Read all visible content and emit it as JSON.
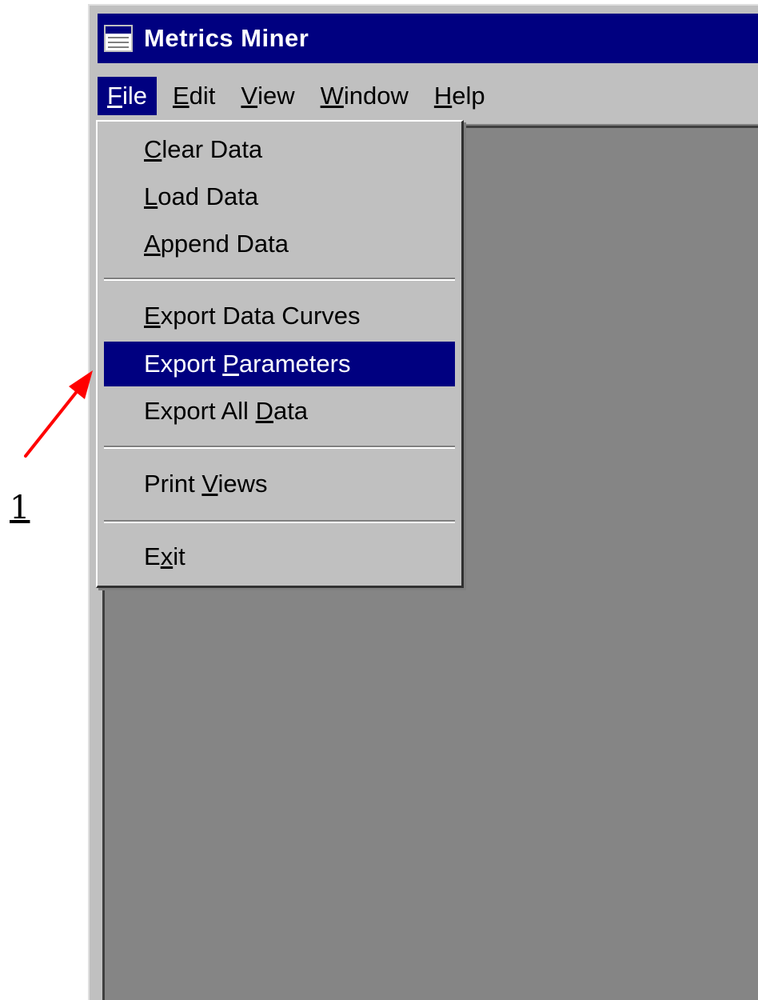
{
  "window": {
    "title": "Metrics Miner"
  },
  "menubar": {
    "items": [
      {
        "label_underline": "F",
        "label_rest": "ile",
        "active": true
      },
      {
        "label_underline": "E",
        "label_rest": "dit",
        "active": false
      },
      {
        "label_underline": "V",
        "label_rest": "iew",
        "active": false
      },
      {
        "label_underline": "W",
        "label_rest": "indow",
        "active": false
      },
      {
        "label_underline": "H",
        "label_rest": "elp",
        "active": false
      }
    ]
  },
  "file_menu": {
    "items": [
      {
        "pre": "",
        "u": "C",
        "post": "lear Data",
        "highlighted": false
      },
      {
        "pre": "",
        "u": "L",
        "post": "oad Data",
        "highlighted": false
      },
      {
        "pre": "",
        "u": "A",
        "post": "ppend Data",
        "highlighted": false
      },
      {
        "pre": "",
        "u": "E",
        "post": "xport Data Curves",
        "highlighted": false
      },
      {
        "pre": "Export ",
        "u": "P",
        "post": "arameters",
        "highlighted": true
      },
      {
        "pre": "Export All ",
        "u": "D",
        "post": "ata",
        "highlighted": false
      },
      {
        "pre": "Print ",
        "u": "V",
        "post": "iews",
        "highlighted": false
      },
      {
        "pre": "E",
        "u": "x",
        "post": "it",
        "highlighted": false
      }
    ]
  },
  "annotation": {
    "label": "1",
    "arrow_color": "#ff0000"
  },
  "colors": {
    "titlebar": "#000080",
    "highlight": "#000080",
    "face": "#c0c0c0",
    "client": "#858585"
  }
}
